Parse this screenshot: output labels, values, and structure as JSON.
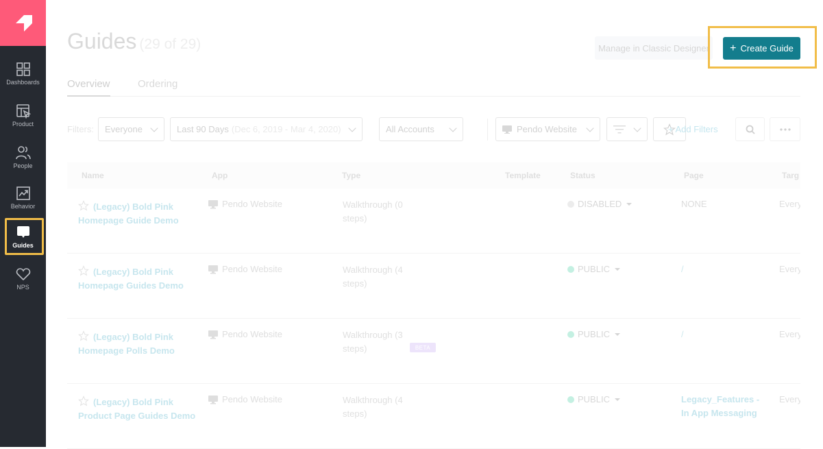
{
  "sidebar": {
    "logo": "pendo-logo-icon",
    "items": [
      {
        "label": "Dashboards",
        "icon": "dashboards-grid-icon",
        "active": false
      },
      {
        "label": "Product",
        "icon": "product-icon",
        "active": false
      },
      {
        "label": "People",
        "icon": "people-icon",
        "active": false
      },
      {
        "label": "Behavior",
        "icon": "behavior-chart-icon",
        "active": false
      },
      {
        "label": "Guides",
        "icon": "guides-speech-bubble-icon",
        "active": true
      },
      {
        "label": "NPS",
        "icon": "heart-icon",
        "active": false
      }
    ]
  },
  "header": {
    "title": "Guides",
    "count": "(29 of 29)",
    "classic_designer_label": "Manage in Classic Designer",
    "create_guide_label": "Create Guide",
    "create_guide_icon": "+"
  },
  "tabs": [
    {
      "label": "Overview",
      "active": true
    },
    {
      "label": "Ordering",
      "active": false
    }
  ],
  "filters": {
    "label": "Filters:",
    "segment": "Everyone",
    "date_range": "Last 90 Days",
    "date_range_detail": "(Dec 6, 2019 - Mar 4, 2020)",
    "accounts": "All Accounts",
    "app": "Pendo Website",
    "add_filters_label": "+ Add Filters"
  },
  "table": {
    "columns": [
      "Name",
      "App",
      "Type",
      "Template",
      "Status",
      "Page",
      "Targ"
    ],
    "rows": [
      {
        "name": "(Legacy) Bold Pink Homepage Guide Demo",
        "app": "Pendo Website",
        "type": "Walkthrough (0 steps)",
        "beta": "",
        "status": "DISABLED",
        "status_color": "#ececec",
        "page": "NONE",
        "page_kind": "plain",
        "target": "Every"
      },
      {
        "name": "(Legacy) Bold Pink Homepage Guides Demo",
        "app": "Pendo Website",
        "type": "Walkthrough (4 steps)",
        "beta": "",
        "status": "PUBLIC",
        "status_color": "#c4f0e2",
        "page": "/",
        "page_kind": "slash",
        "target": "Every"
      },
      {
        "name": "(Legacy) Bold Pink Homepage Polls Demo",
        "app": "Pendo Website",
        "type": "Walkthrough (3 steps)",
        "beta": "BETA",
        "status": "PUBLIC",
        "status_color": "#c4f0e2",
        "page": "/",
        "page_kind": "slash",
        "target": "Every"
      },
      {
        "name": "(Legacy) Bold Pink Product Page Guides Demo",
        "app": "Pendo Website",
        "type": "Walkthrough (4 steps)",
        "beta": "",
        "status": "PUBLIC",
        "status_color": "#c4f0e2",
        "page": "Legacy_Features - In App Messaging",
        "page_kind": "link",
        "target": "Every"
      }
    ]
  },
  "colors": {
    "brand_pink": "#fe5a79",
    "sidebar_bg": "#262a31",
    "primary_button": "#137d8d",
    "highlight": "#f1bd48"
  }
}
